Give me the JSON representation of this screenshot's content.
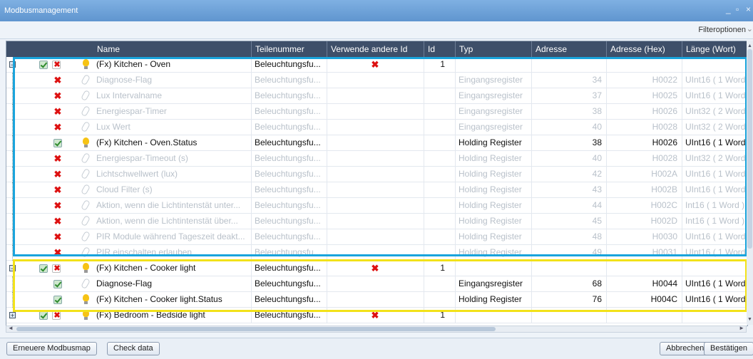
{
  "window": {
    "title": "Modbusmanagement"
  },
  "filter": {
    "label": "Filteroptionen"
  },
  "columns": [
    "Name",
    "Teilenummer",
    "Verwende andere Id",
    "Id",
    "Typ",
    "Adresse",
    "Adresse (Hex)",
    "Länge (Wort)"
  ],
  "rows": [
    {
      "level": 0,
      "expander": "−",
      "checkbox": "checked",
      "icon": "bulb",
      "name": "(Fx) Kitchen - Oven",
      "part": "Beleuchtungsfu...",
      "other_id": "x",
      "id": "1",
      "type": "",
      "address": "",
      "hex": "",
      "length": "",
      "dim": false,
      "bold": false
    },
    {
      "level": 1,
      "checkbox": "x",
      "icon": "clip",
      "name": "Diagnose-Flag",
      "part": "Beleuchtungsfu...",
      "other_id": "",
      "id": "",
      "type": "Eingangsregister",
      "address": "34",
      "hex": "H0022",
      "length": "UInt16 ( 1 Word",
      "dim": true,
      "bold": false
    },
    {
      "level": 1,
      "checkbox": "x",
      "icon": "clip",
      "name": "Lux Intervalname",
      "part": "Beleuchtungsfu...",
      "other_id": "",
      "id": "",
      "type": "Eingangsregister",
      "address": "37",
      "hex": "H0025",
      "length": "UInt16 ( 1 Word",
      "dim": true,
      "bold": false
    },
    {
      "level": 1,
      "checkbox": "x",
      "icon": "clip",
      "name": "Energiespar-Timer",
      "part": "Beleuchtungsfu...",
      "other_id": "",
      "id": "",
      "type": "Eingangsregister",
      "address": "38",
      "hex": "H0026",
      "length": "UInt32 ( 2 Word",
      "dim": true,
      "bold": false
    },
    {
      "level": 1,
      "checkbox": "x",
      "icon": "clip",
      "name": "Lux Wert",
      "part": "Beleuchtungsfu...",
      "other_id": "",
      "id": "",
      "type": "Eingangsregister",
      "address": "40",
      "hex": "H0028",
      "length": "UInt32 ( 2 Word",
      "dim": true,
      "bold": false
    },
    {
      "level": 1,
      "checkbox": "checked",
      "icon": "bulb",
      "name": "(Fx) Kitchen - Oven.Status",
      "part": "Beleuchtungsfu...",
      "other_id": "",
      "id": "",
      "type": "Holding Register",
      "address": "38",
      "hex": "H0026",
      "length": "UInt16 ( 1 Word",
      "dim": false,
      "bold": false
    },
    {
      "level": 1,
      "checkbox": "x",
      "icon": "clip",
      "name": "Energiespar-Timeout (s)",
      "part": "Beleuchtungsfu...",
      "other_id": "",
      "id": "",
      "type": "Holding Register",
      "address": "40",
      "hex": "H0028",
      "length": "UInt32 ( 2 Word",
      "dim": true,
      "bold": false
    },
    {
      "level": 1,
      "checkbox": "x",
      "icon": "clip",
      "name": "Lichtschwellwert (lux)",
      "part": "Beleuchtungsfu...",
      "other_id": "",
      "id": "",
      "type": "Holding Register",
      "address": "42",
      "hex": "H002A",
      "length": "UInt16 ( 1 Word",
      "dim": true,
      "bold": false
    },
    {
      "level": 1,
      "checkbox": "x",
      "icon": "clip",
      "name": "Cloud Filter (s)",
      "part": "Beleuchtungsfu...",
      "other_id": "",
      "id": "",
      "type": "Holding Register",
      "address": "43",
      "hex": "H002B",
      "length": "UInt16 ( 1 Word",
      "dim": true,
      "bold": false
    },
    {
      "level": 1,
      "checkbox": "x",
      "icon": "clip",
      "name": "Aktion, wenn die Lichtintenstät unter...",
      "part": "Beleuchtungsfu...",
      "other_id": "",
      "id": "",
      "type": "Holding Register",
      "address": "44",
      "hex": "H002C",
      "length": "Int16 ( 1 Word )",
      "dim": true,
      "bold": false
    },
    {
      "level": 1,
      "checkbox": "x",
      "icon": "clip",
      "name": "Aktion, wenn die Lichtintenstät über...",
      "part": "Beleuchtungsfu...",
      "other_id": "",
      "id": "",
      "type": "Holding Register",
      "address": "45",
      "hex": "H002D",
      "length": "Int16 ( 1 Word )",
      "dim": true,
      "bold": false
    },
    {
      "level": 1,
      "checkbox": "x",
      "icon": "clip",
      "name": "PIR Module während Tageszeit deakt...",
      "part": "Beleuchtungsfu...",
      "other_id": "",
      "id": "",
      "type": "Holding Register",
      "address": "48",
      "hex": "H0030",
      "length": "UInt16 ( 1 Word",
      "dim": true,
      "bold": false
    },
    {
      "level": 1,
      "checkbox": "x",
      "icon": "clip",
      "name": "PIR einschalten erlauben",
      "part": "Beleuchtungsfu...",
      "other_id": "",
      "id": "",
      "type": "Holding Register",
      "address": "49",
      "hex": "H0031",
      "length": "UInt16 ( 1 Word",
      "dim": true,
      "bold": false
    },
    {
      "level": 0,
      "expander": "−",
      "checkbox": "checked",
      "icon": "bulb",
      "name": "(Fx) Kitchen - Cooker light",
      "part": "Beleuchtungsfu...",
      "other_id": "x",
      "id": "1",
      "type": "",
      "address": "",
      "hex": "",
      "length": "",
      "dim": false,
      "bold": false
    },
    {
      "level": 1,
      "checkbox": "checked",
      "icon": "clip",
      "name": "Diagnose-Flag",
      "part": "Beleuchtungsfu...",
      "other_id": "",
      "id": "",
      "type": "Eingangsregister",
      "address": "68",
      "hex": "H0044",
      "length": "UInt16 ( 1 Word",
      "dim": false,
      "bold": false
    },
    {
      "level": 1,
      "checkbox": "checked",
      "icon": "bulb",
      "name": "(Fx) Kitchen - Cooker light.Status",
      "part": "Beleuchtungsfu...",
      "other_id": "",
      "id": "",
      "type": "Holding Register",
      "address": "76",
      "hex": "H004C",
      "length": "UInt16 ( 1 Word",
      "dim": false,
      "bold": false
    },
    {
      "level": 0,
      "expander": "+",
      "checkbox": "checked",
      "icon": "bulb",
      "name": "(Fx) Bedroom - Bedside light",
      "part": "Beleuchtungsfu...",
      "other_id": "x",
      "id": "1",
      "type": "",
      "address": "",
      "hex": "",
      "length": "",
      "dim": false,
      "bold": false
    }
  ],
  "buttons": {
    "renew": "Erneuere Modbusmap",
    "check": "Check data",
    "cancel": "Abbrechen",
    "confirm": "Bestätigen"
  },
  "colors": {
    "highlight_blue": "#1aa4dc",
    "highlight_yellow": "#f2e21a",
    "header_bg": "#3e4f69"
  }
}
